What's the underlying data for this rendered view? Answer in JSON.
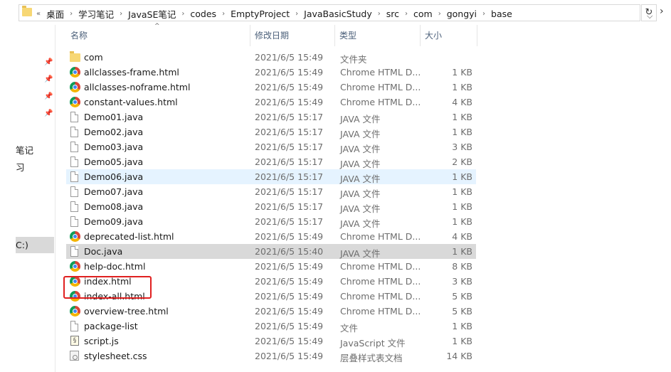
{
  "address": {
    "prefix": "«",
    "crumbs": [
      "桌面",
      "学习笔记",
      "JavaSE笔记",
      "codes",
      "EmptyProject",
      "JavaBasicStudy",
      "src",
      "com",
      "gongyi",
      "base"
    ],
    "separator": "›",
    "dropdown_icon": "chevron-down-icon",
    "refresh_icon": "refresh-icon"
  },
  "nav": {
    "pins": [
      "pin-icon",
      "pin-icon",
      "pin-icon",
      "pin-icon"
    ],
    "items": [
      "笔记",
      "习"
    ],
    "selected_item": "C:)"
  },
  "columns": {
    "name": "名称",
    "date": "修改日期",
    "type": "类型",
    "size": "大小"
  },
  "files": [
    {
      "name": "com",
      "date": "2021/6/5 15:49",
      "type": "文件夹",
      "size": "",
      "icon": "folder"
    },
    {
      "name": "allclasses-frame.html",
      "date": "2021/6/5 15:49",
      "type": "Chrome HTML D...",
      "size": "1 KB",
      "icon": "chrome"
    },
    {
      "name": "allclasses-noframe.html",
      "date": "2021/6/5 15:49",
      "type": "Chrome HTML D...",
      "size": "1 KB",
      "icon": "chrome"
    },
    {
      "name": "constant-values.html",
      "date": "2021/6/5 15:49",
      "type": "Chrome HTML D...",
      "size": "4 KB",
      "icon": "chrome"
    },
    {
      "name": "Demo01.java",
      "date": "2021/6/5 15:17",
      "type": "JAVA 文件",
      "size": "1 KB",
      "icon": "file"
    },
    {
      "name": "Demo02.java",
      "date": "2021/6/5 15:17",
      "type": "JAVA 文件",
      "size": "1 KB",
      "icon": "file"
    },
    {
      "name": "Demo03.java",
      "date": "2021/6/5 15:17",
      "type": "JAVA 文件",
      "size": "3 KB",
      "icon": "file"
    },
    {
      "name": "Demo05.java",
      "date": "2021/6/5 15:17",
      "type": "JAVA 文件",
      "size": "2 KB",
      "icon": "file"
    },
    {
      "name": "Demo06.java",
      "date": "2021/6/5 15:17",
      "type": "JAVA 文件",
      "size": "1 KB",
      "icon": "file",
      "state": "hover"
    },
    {
      "name": "Demo07.java",
      "date": "2021/6/5 15:17",
      "type": "JAVA 文件",
      "size": "1 KB",
      "icon": "file"
    },
    {
      "name": "Demo08.java",
      "date": "2021/6/5 15:17",
      "type": "JAVA 文件",
      "size": "1 KB",
      "icon": "file"
    },
    {
      "name": "Demo09.java",
      "date": "2021/6/5 15:17",
      "type": "JAVA 文件",
      "size": "1 KB",
      "icon": "file"
    },
    {
      "name": "deprecated-list.html",
      "date": "2021/6/5 15:49",
      "type": "Chrome HTML D...",
      "size": "4 KB",
      "icon": "chrome"
    },
    {
      "name": "Doc.java",
      "date": "2021/6/5 15:40",
      "type": "JAVA 文件",
      "size": "1 KB",
      "icon": "file",
      "state": "selected"
    },
    {
      "name": "help-doc.html",
      "date": "2021/6/5 15:49",
      "type": "Chrome HTML D...",
      "size": "8 KB",
      "icon": "chrome"
    },
    {
      "name": "index.html",
      "date": "2021/6/5 15:49",
      "type": "Chrome HTML D...",
      "size": "3 KB",
      "icon": "chrome"
    },
    {
      "name": "index-all.html",
      "date": "2021/6/5 15:49",
      "type": "Chrome HTML D...",
      "size": "5 KB",
      "icon": "chrome"
    },
    {
      "name": "overview-tree.html",
      "date": "2021/6/5 15:49",
      "type": "Chrome HTML D...",
      "size": "5 KB",
      "icon": "chrome"
    },
    {
      "name": "package-list",
      "date": "2021/6/5 15:49",
      "type": "文件",
      "size": "1 KB",
      "icon": "file"
    },
    {
      "name": "script.js",
      "date": "2021/6/5 15:49",
      "type": "JavaScript 文件",
      "size": "1 KB",
      "icon": "js"
    },
    {
      "name": "stylesheet.css",
      "date": "2021/6/5 15:49",
      "type": "层叠样式表文档",
      "size": "14 KB",
      "icon": "css"
    }
  ],
  "annotation": {
    "color": "#e02020"
  }
}
